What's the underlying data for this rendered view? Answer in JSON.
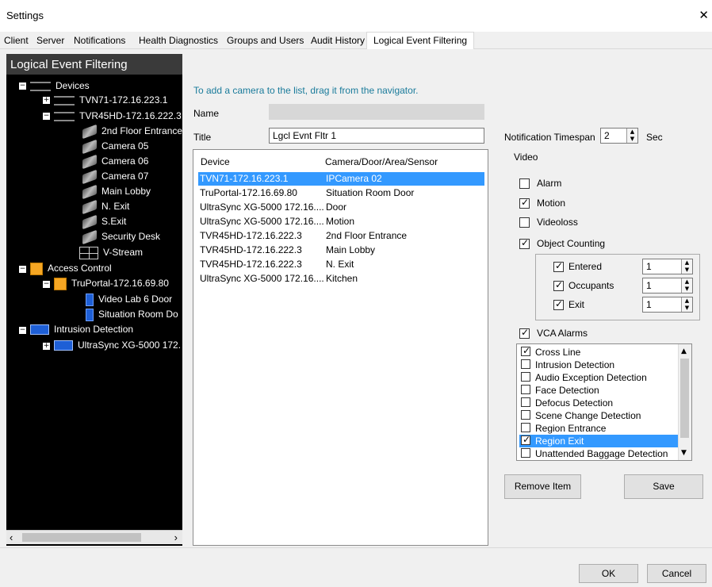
{
  "window": {
    "title": "Settings",
    "close_icon": "close-icon"
  },
  "tabs": [
    "Client",
    "Server",
    "Notifications",
    "Health Diagnostics",
    "Groups and Users",
    "Audit History",
    "Logical Event Filtering"
  ],
  "nav": {
    "header": "Logical Event Filtering",
    "tree": {
      "devices": "Devices",
      "tvn71": "TVN71-172.16.223.1",
      "tvr45": "TVR45HD-172.16.222.3",
      "cams": [
        "2nd Floor Entrance",
        "Camera 05",
        "Camera 06",
        "Camera 07",
        "Main Lobby",
        "N. Exit",
        "S.Exit",
        "Security Desk"
      ],
      "vstream": "V-Stream",
      "access": "Access Control",
      "truportal": "TruPortal-172.16.69.80",
      "doors": [
        "Video Lab 6 Door",
        "Situation Room Do"
      ],
      "intrusion": "Intrusion Detection",
      "ultrasync": "UltraSync XG-5000 172."
    }
  },
  "main": {
    "hint": "To add a camera to the list, drag it from the navigator.",
    "name_label": "Name",
    "name_value": "",
    "title_label": "Title",
    "title_value": "Lgcl Evnt Fltr 1",
    "list": {
      "col_device": "Device",
      "col_camera": "Camera/Door/Area/Sensor",
      "rows": [
        {
          "device": "TVN71-172.16.223.1",
          "camera": "IPCamera 02"
        },
        {
          "device": "TruPortal-172.16.69.80",
          "camera": "Situation Room Door"
        },
        {
          "device": "UltraSync XG-5000 172.16....",
          "camera": "Door"
        },
        {
          "device": "UltraSync XG-5000 172.16....",
          "camera": "Motion"
        },
        {
          "device": "TVR45HD-172.16.222.3",
          "camera": "2nd Floor Entrance"
        },
        {
          "device": "TVR45HD-172.16.222.3",
          "camera": "Main Lobby"
        },
        {
          "device": "TVR45HD-172.16.222.3",
          "camera": "N. Exit"
        },
        {
          "device": "UltraSync XG-5000 172.16....",
          "camera": "Kitchen"
        }
      ]
    }
  },
  "right": {
    "timespan_label": "Notification Timespan",
    "timespan_value": "2",
    "timespan_unit": "Sec",
    "video_label": "Video",
    "alarm": "Alarm",
    "motion": "Motion",
    "videoloss": "Videoloss",
    "object_counting": "Object Counting",
    "entered": "Entered",
    "entered_value": "1",
    "occupants": "Occupants",
    "occupants_value": "1",
    "exit": "Exit",
    "exit_value": "1",
    "vca_alarms": "VCA Alarms",
    "vca_items": [
      "Cross Line",
      "Intrusion Detection",
      "Audio Exception Detection",
      "Face Detection",
      "Defocus Detection",
      "Scene Change Detection",
      "Region Entrance",
      "Region Exit",
      "Unattended Baggage Detection"
    ],
    "remove_item": "Remove Item",
    "save": "Save"
  },
  "footer": {
    "ok": "OK",
    "cancel": "Cancel"
  },
  "colors": {
    "selection": "#3399ff",
    "hint": "#1a7b9b",
    "nav_bg": "#000000"
  }
}
